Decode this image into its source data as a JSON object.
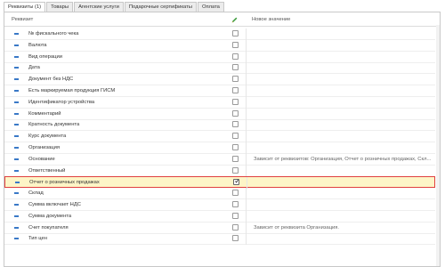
{
  "tabs": [
    {
      "label": "Реквизиты (1)",
      "active": true
    },
    {
      "label": "Товары",
      "active": false
    },
    {
      "label": "Агентские услуги",
      "active": false
    },
    {
      "label": "Подарочные сертификаты",
      "active": false
    },
    {
      "label": "Оплата",
      "active": false
    }
  ],
  "table": {
    "col_requisite": "Реквизит",
    "col_new_value": "Новое значение",
    "edit_icon": "pencil-icon",
    "rows": [
      {
        "label": "№ фискального чека",
        "checked": false,
        "value": ""
      },
      {
        "label": "Валюта",
        "checked": false,
        "value": ""
      },
      {
        "label": "Вид операции",
        "checked": false,
        "value": ""
      },
      {
        "label": "Дата",
        "checked": false,
        "value": ""
      },
      {
        "label": "Документ без НДС",
        "checked": false,
        "value": ""
      },
      {
        "label": "Есть маркируемая продукция ГИСМ",
        "checked": false,
        "value": ""
      },
      {
        "label": "Идентификатор устройства",
        "checked": false,
        "value": ""
      },
      {
        "label": "Комментарий",
        "checked": false,
        "value": ""
      },
      {
        "label": "Кратность документа",
        "checked": false,
        "value": ""
      },
      {
        "label": "Курс документа",
        "checked": false,
        "value": ""
      },
      {
        "label": "Организация",
        "checked": false,
        "value": ""
      },
      {
        "label": "Основание",
        "checked": false,
        "value": "Зависит от реквизитов: Организация, Отчет о розничных продажах, Скл..."
      },
      {
        "label": "Ответственный",
        "checked": false,
        "value": ""
      },
      {
        "label": "Отчет о розничных продажах",
        "checked": true,
        "value": "",
        "selected": true
      },
      {
        "label": "Склад",
        "checked": false,
        "value": ""
      },
      {
        "label": "Сумма включает НДС",
        "checked": false,
        "value": ""
      },
      {
        "label": "Сумма документа",
        "checked": false,
        "value": ""
      },
      {
        "label": "Счет покупателя",
        "checked": false,
        "value": "Зависит от реквизита Организация."
      },
      {
        "label": "Тип цен",
        "checked": false,
        "value": ""
      }
    ]
  },
  "colors": {
    "accent": "#3a79c7",
    "selected_bg": "#fdf5c7",
    "selected_border": "#e04040"
  }
}
